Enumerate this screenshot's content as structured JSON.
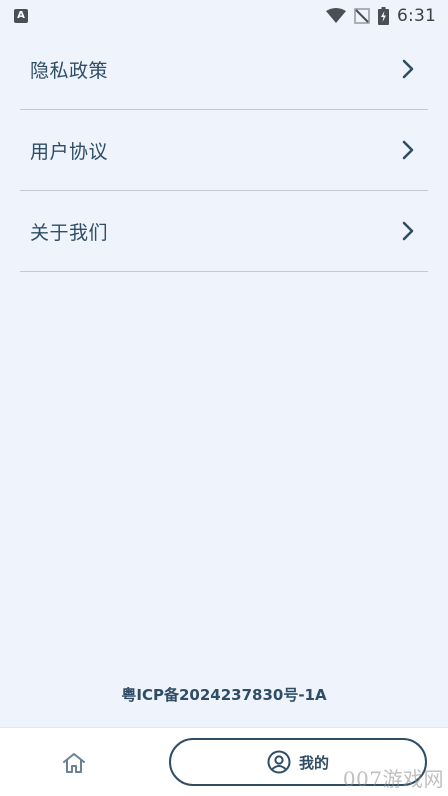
{
  "status_bar": {
    "notification_icon": "A",
    "time": "6:31",
    "icons": [
      "wifi-icon",
      "signal-off-icon",
      "battery-charging-icon"
    ]
  },
  "menu": {
    "items": [
      {
        "label": "隐私政策",
        "icon": "chevron-right-icon"
      },
      {
        "label": "用户协议",
        "icon": "chevron-right-icon"
      },
      {
        "label": "关于我们",
        "icon": "chevron-right-icon"
      }
    ]
  },
  "footer": {
    "icp": "粤ICP备2024237830号-1A"
  },
  "bottom_nav": {
    "home_icon": "home-icon",
    "mine_label": "我的",
    "mine_icon": "user-circle-icon"
  },
  "watermark": "007游戏网",
  "colors": {
    "background": "#eef3fc",
    "primary_text": "#2f4e66",
    "divider": "#c3c9d2",
    "nav_background": "#ffffff"
  }
}
